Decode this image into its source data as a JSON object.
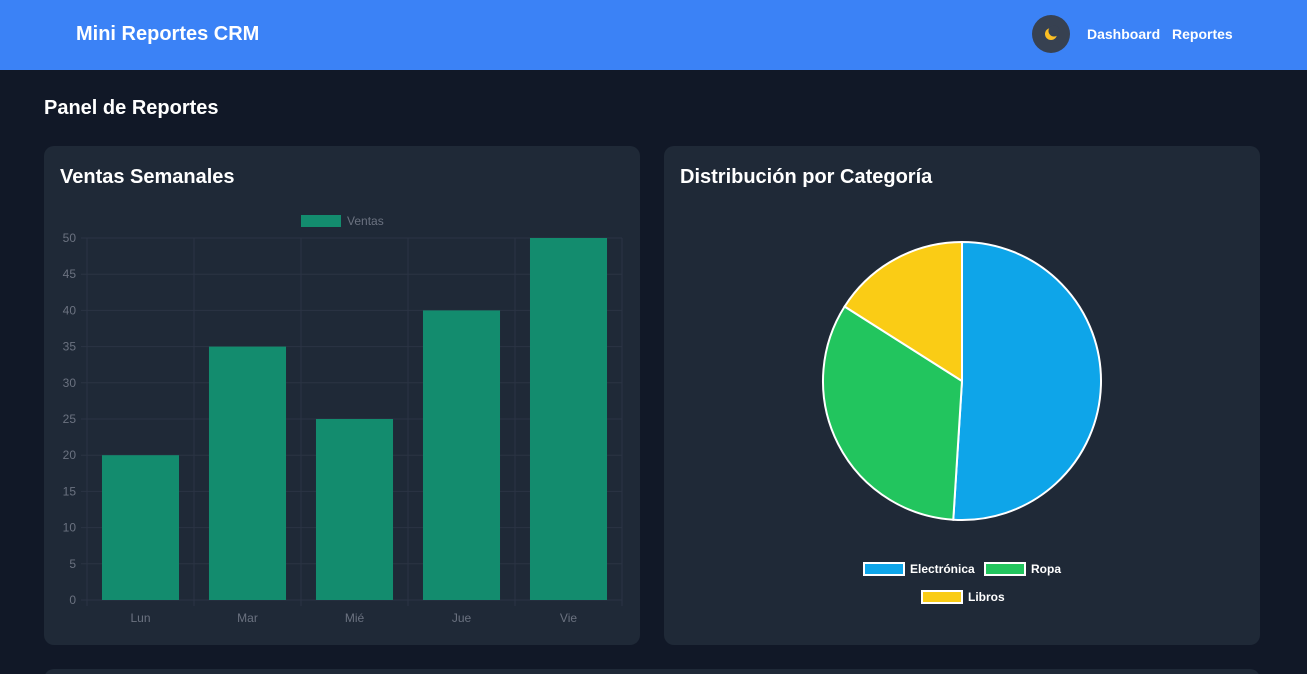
{
  "app": {
    "brand": "Mini Reportes CRM"
  },
  "nav": {
    "theme_icon": "moon-icon",
    "links": [
      {
        "label": "Dashboard"
      },
      {
        "label": "Reportes"
      }
    ]
  },
  "page": {
    "title": "Panel de Reportes"
  },
  "colors": {
    "navbar": "#3b82f6",
    "background": "#111827",
    "card": "#1f2937",
    "bar": "#138c6e",
    "electronica": "#0ea5e9",
    "ropa": "#22c55e",
    "libros": "#facc15"
  },
  "cards": {
    "sales_title": "Ventas Semanales",
    "category_title": "Distribución por Categoría"
  },
  "chart_data": [
    {
      "type": "bar",
      "title": "Ventas Semanales",
      "categories": [
        "Lun",
        "Mar",
        "Mié",
        "Jue",
        "Vie"
      ],
      "series": [
        {
          "name": "Ventas",
          "values": [
            20,
            35,
            25,
            40,
            50
          ]
        }
      ],
      "ylim": [
        0,
        50
      ],
      "yticks": [
        0,
        5,
        10,
        15,
        20,
        25,
        30,
        35,
        40,
        45,
        50
      ],
      "grid": true,
      "legend": "top"
    },
    {
      "type": "pie",
      "title": "Distribución por Categoría",
      "labels": [
        "Electrónica",
        "Ropa",
        "Libros"
      ],
      "values": [
        51,
        33,
        16
      ],
      "legend": "bottom"
    }
  ]
}
